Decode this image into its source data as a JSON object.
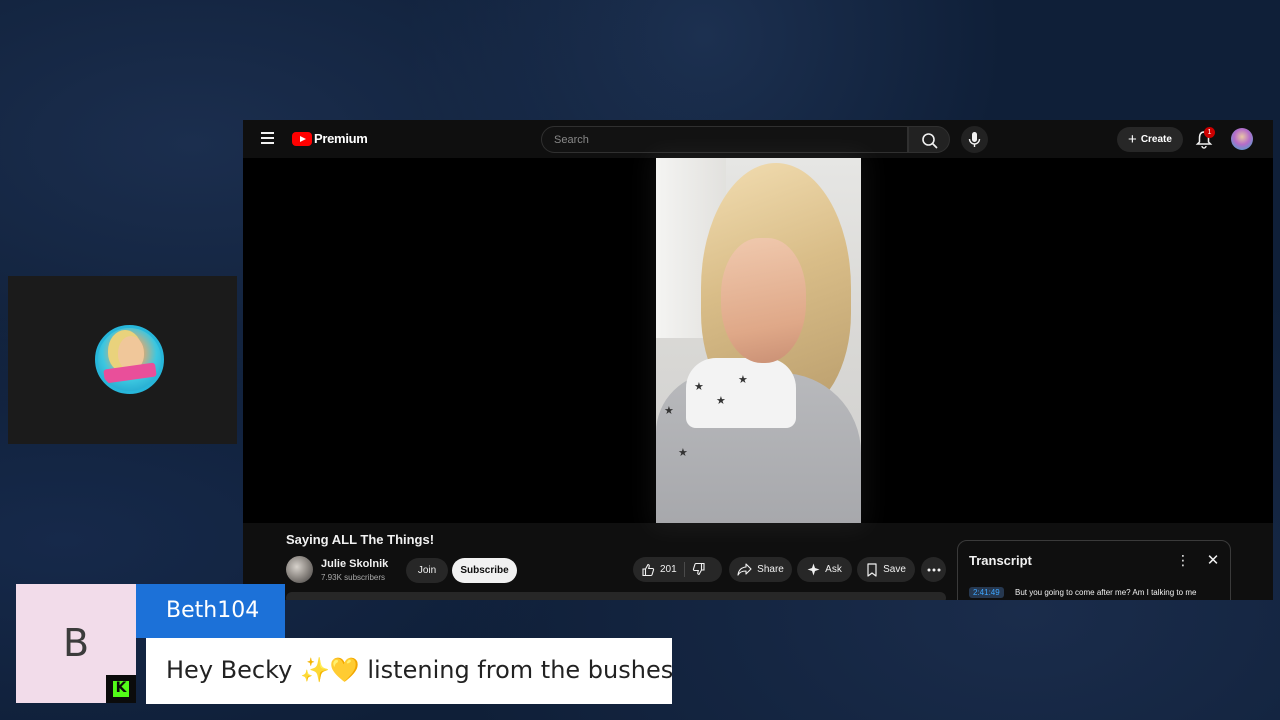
{
  "youtube": {
    "brand": "Premium",
    "search": {
      "placeholder": "Search"
    },
    "create_label": "Create",
    "notification_count": "1",
    "video": {
      "title": "Saying ALL The Things!",
      "channel_name": "Julie Skolnik",
      "subscribers": "7.93K subscribers",
      "join_label": "Join",
      "subscribe_label": "Subscribe",
      "likes": "201",
      "share_label": "Share",
      "ask_label": "Ask",
      "save_label": "Save"
    },
    "transcript": {
      "title": "Transcript",
      "entries": [
        {
          "time": "2:41:49",
          "text": "But you going to come after me? Am I talking to me"
        }
      ]
    }
  },
  "chat": {
    "avatar_letter": "B",
    "username": "Beth104",
    "message": "Hey Becky ✨💛 listening from the bushes",
    "platform_icon": "kick-icon"
  },
  "colors": {
    "background": "#0f1f38",
    "yt_red": "#ff0000",
    "chat_name_bg": "#1c71d8",
    "kick_green": "#53fc18",
    "avatar_bg": "#f2dcea"
  }
}
